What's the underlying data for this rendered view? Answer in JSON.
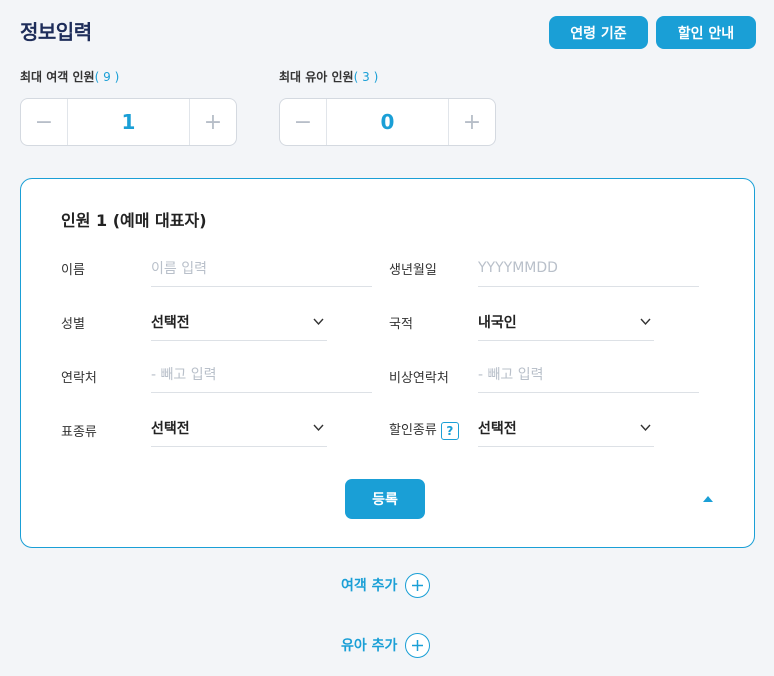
{
  "header": {
    "title": "정보입력",
    "age_button": "연령 기준",
    "discount_button": "할인 안내"
  },
  "counters": {
    "adult": {
      "label": "최대 여객 인원",
      "max": "9",
      "value": "1"
    },
    "infant": {
      "label": "최대 유아 인원",
      "max": "3",
      "value": "0"
    },
    "minus_glyph": "−",
    "plus_glyph": "+"
  },
  "passenger_card": {
    "title": "인원 1 (예매 대표자)",
    "fields": {
      "name": {
        "label": "이름",
        "placeholder": "이름 입력"
      },
      "birth": {
        "label": "생년월일",
        "placeholder": "YYYYMMDD"
      },
      "gender": {
        "label": "성별",
        "value": "선택전"
      },
      "nationality": {
        "label": "국적",
        "value": "내국인"
      },
      "phone": {
        "label": "연락처",
        "placeholder": "- 빼고 입력"
      },
      "emergency": {
        "label": "비상연락처",
        "placeholder": "- 빼고 입력"
      },
      "ticket_type": {
        "label": "표종류",
        "value": "선택전"
      },
      "discount_type": {
        "label": "할인종류",
        "help": "?",
        "value": "선택전"
      }
    },
    "register_button": "등록"
  },
  "add_actions": {
    "add_passenger": "여객 추가",
    "add_infant": "유아 추가"
  },
  "colors": {
    "accent": "#1a9fd6",
    "title": "#1e2d5a",
    "background": "#f3f5f8"
  },
  "icons": {
    "chevron": "chevron-down-icon",
    "collapse": "caret-up-icon",
    "add": "plus-circle-icon",
    "help": "question-icon"
  }
}
